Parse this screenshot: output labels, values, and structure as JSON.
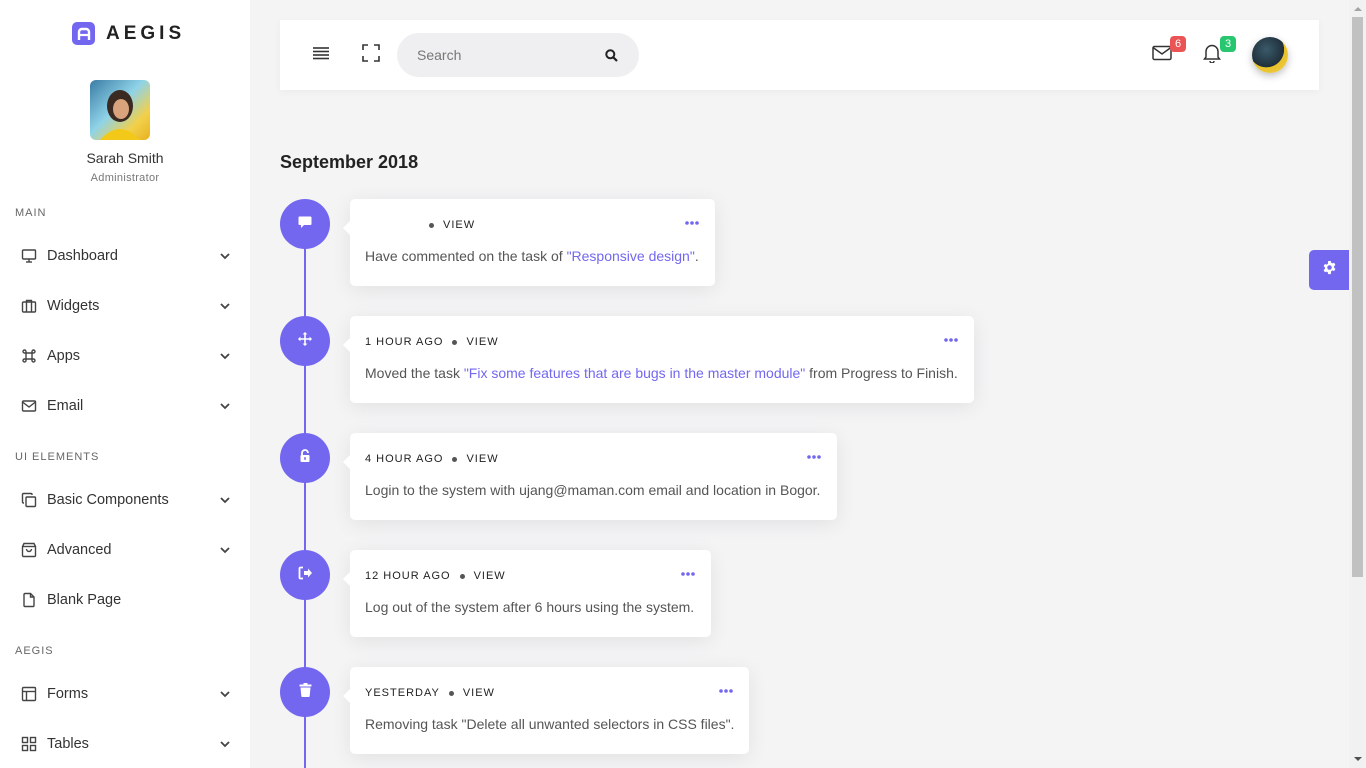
{
  "brand": {
    "name": "AEGIS",
    "color": "#7367f0"
  },
  "profile": {
    "name": "Sarah Smith",
    "role": "Administrator"
  },
  "sidebar": {
    "sections": [
      {
        "label": "MAIN"
      },
      {
        "label": "UI ELEMENTS"
      },
      {
        "label": "AEGIS"
      }
    ],
    "items": [
      {
        "label": "Dashboard",
        "icon": "monitor-icon",
        "has_submenu": true
      },
      {
        "label": "Widgets",
        "icon": "briefcase-icon",
        "has_submenu": true
      },
      {
        "label": "Apps",
        "icon": "command-icon",
        "has_submenu": true
      },
      {
        "label": "Email",
        "icon": "mail-icon",
        "has_submenu": true
      },
      {
        "label": "Basic Components",
        "icon": "copy-icon",
        "has_submenu": true
      },
      {
        "label": "Advanced",
        "icon": "shopping-bag-icon",
        "has_submenu": true
      },
      {
        "label": "Blank Page",
        "icon": "file-icon",
        "has_submenu": false
      },
      {
        "label": "Forms",
        "icon": "layout-icon",
        "has_submenu": true
      },
      {
        "label": "Tables",
        "icon": "grid-icon",
        "has_submenu": true
      }
    ]
  },
  "header": {
    "search": {
      "placeholder": "Search",
      "value": ""
    },
    "mail_badge": "6",
    "notification_badge": "3",
    "badge_colors": {
      "mail": "#ea5455",
      "notifications": "#28c76f"
    }
  },
  "timeline": {
    "month": "September 2018",
    "entries": [
      {
        "icon": "comment-icon",
        "time": "",
        "view": "VIEW",
        "text_before": "Have commented on the task of ",
        "link": "\"Responsive design\"",
        "text_after": "."
      },
      {
        "icon": "move-icon",
        "time": "1 HOUR AGO",
        "view": "VIEW",
        "text_before": "Moved the task ",
        "link": "\"Fix some features that are bugs in the master module\"",
        "text_after": " from Progress to Finish."
      },
      {
        "icon": "unlock-icon",
        "time": "4 HOUR AGO",
        "view": "VIEW",
        "text_before": "Login to the system with ujang@maman.com email and location in Bogor.",
        "link": "",
        "text_after": ""
      },
      {
        "icon": "sign-out-icon",
        "time": "12 HOUR AGO",
        "view": "VIEW",
        "text_before": "Log out of the system after 6 hours using the system.",
        "link": "",
        "text_after": ""
      },
      {
        "icon": "trash-icon",
        "time": "YESTERDAY",
        "view": "VIEW",
        "text_before": "Removing task \"Delete all unwanted selectors in CSS files\".",
        "link": "",
        "text_after": ""
      }
    ]
  }
}
